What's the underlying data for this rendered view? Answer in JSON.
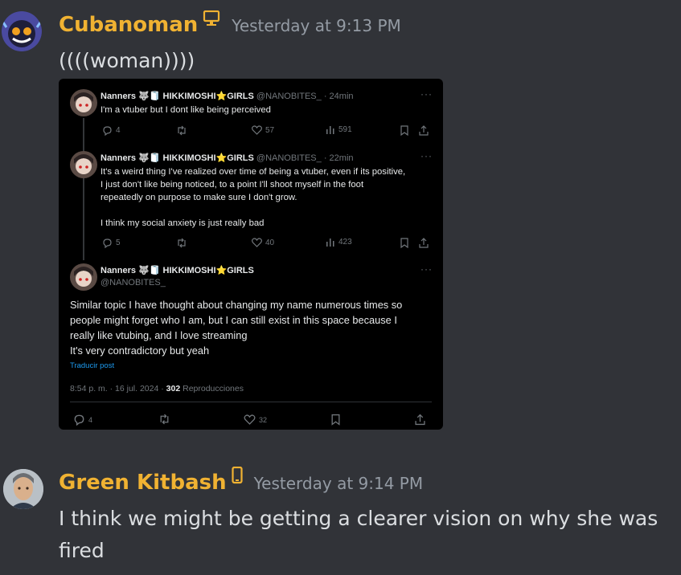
{
  "messages": [
    {
      "author": "Cubanoman",
      "device_icon": "desktop-icon",
      "timestamp": "Yesterday at 9:13 PM",
      "text": "((((woman))))"
    },
    {
      "author": "Green Kitbash",
      "device_icon": "mobile-icon",
      "timestamp": "Yesterday at 9:14 PM",
      "text": "I think we might be getting a clearer vision on why she was fired"
    }
  ],
  "embed": {
    "tweets": [
      {
        "name": "Nanners 🐺🧻 HIKKIMOSHI⭐GIRLS",
        "handle": "@NANOBITES_",
        "age": "· 24min",
        "text": "I'm a vtuber but I dont like being perceived",
        "replies": "4",
        "likes": "57",
        "views": "591"
      },
      {
        "name": "Nanners 🐺🧻 HIKKIMOSHI⭐GIRLS",
        "handle": "@NANOBITES_",
        "age": "· 22min",
        "text_line1": "It's a weird thing I've realized over time of being a vtuber, even if its positive,",
        "text_line2": "I just don't like being noticed, to a point I'll shoot myself in the foot",
        "text_line3": "repeatedly on purpose to make sure I don't grow.",
        "text_line4": "I think my social anxiety is just really bad",
        "replies": "5",
        "likes": "40",
        "views": "423"
      }
    ],
    "main": {
      "name": "Nanners 🐺🧻 HIKKIMOSHI⭐GIRLS",
      "handle": "@NANOBITES_",
      "text_line1": "Similar topic I have thought about changing my name numerous times so",
      "text_line2": "people might forget who I am, but I can still exist in this space because I",
      "text_line3": "really like vtubing, and I love streaming",
      "text_line4": "It's very contradictory but yeah",
      "translate": "Traducir post",
      "meta_time": "8:54 p. m. · 16 jul. 2024 · ",
      "meta_views": "302",
      "meta_views_label": " Reproducciones",
      "replies": "4",
      "likes": "32"
    }
  },
  "colors": {
    "background": "#313338",
    "author_gold": "#f0b232",
    "timestamp": "#949ba4",
    "tweet_bg": "#000000",
    "link_blue": "#1d9bf0"
  }
}
